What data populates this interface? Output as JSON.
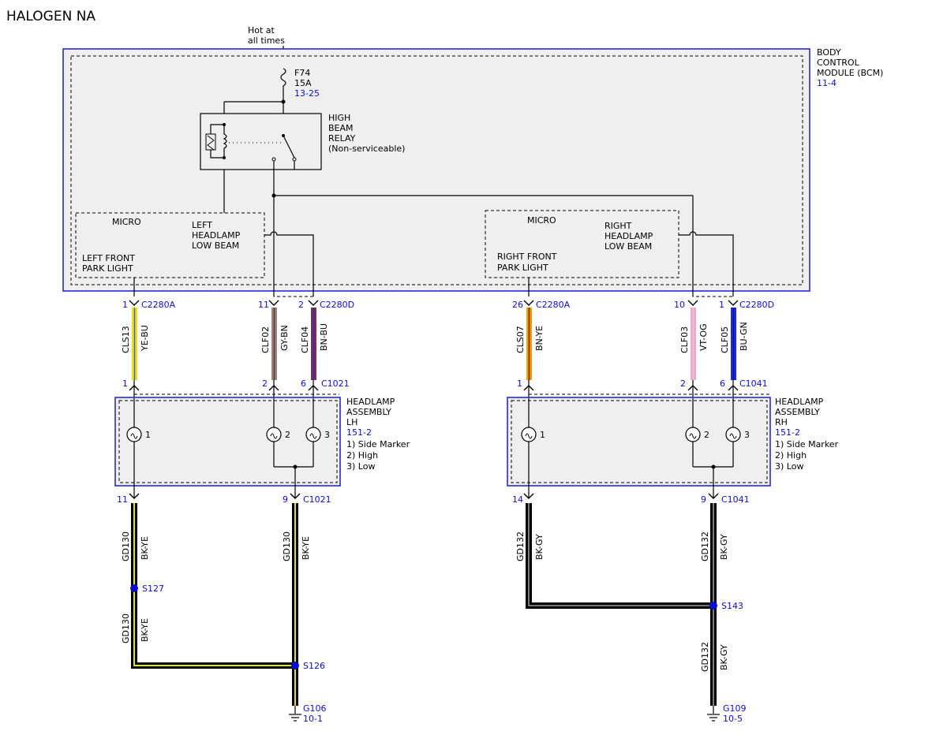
{
  "title": "HALOGEN NA",
  "power": {
    "line1": "Hot at",
    "line2": "all times"
  },
  "fuse": {
    "name": "F74",
    "rating": "15A",
    "ref": "13-25"
  },
  "bcm": {
    "line1": "BODY",
    "line2": "CONTROL",
    "line3": "MODULE (BCM)",
    "ref": "11-4"
  },
  "relay": {
    "line1": "HIGH",
    "line2": "BEAM",
    "line3": "RELAY",
    "line4": "(Non-serviceable)"
  },
  "micro_left": {
    "title": "MICRO",
    "low_beam": [
      "LEFT",
      "HEADLAMP",
      "LOW BEAM"
    ],
    "park": [
      "LEFT FRONT",
      "PARK LIGHT"
    ]
  },
  "micro_right": {
    "title": "MICRO",
    "low_beam": [
      "RIGHT",
      "HEADLAMP",
      "LOW BEAM"
    ],
    "park": [
      "RIGHT FRONT",
      "PARK LIGHT"
    ]
  },
  "wires": [
    {
      "circuit": "CLS13",
      "color_code": "YE-BU",
      "top_pin": "1",
      "top_conn": "C2280A",
      "bot_pin": "1",
      "bot_conn": ""
    },
    {
      "circuit": "CLF02",
      "color_code": "GY-BN",
      "top_pin": "11",
      "top_conn": "",
      "bot_pin": "2",
      "bot_conn": ""
    },
    {
      "circuit": "CLF04",
      "color_code": "BN-BU",
      "top_pin": "2",
      "top_conn": "C2280D",
      "bot_pin": "6",
      "bot_conn": "C1021"
    },
    {
      "circuit": "CLS07",
      "color_code": "BN-YE",
      "top_pin": "26",
      "top_conn": "C2280A",
      "bot_pin": "1",
      "bot_conn": ""
    },
    {
      "circuit": "CLF03",
      "color_code": "VT-OG",
      "top_pin": "10",
      "top_conn": "",
      "bot_pin": "2",
      "bot_conn": ""
    },
    {
      "circuit": "CLF05",
      "color_code": "BU-GN",
      "top_pin": "1",
      "top_conn": "C2280D",
      "bot_pin": "6",
      "bot_conn": "C1041"
    }
  ],
  "headlamp_lh": {
    "title": [
      "HEADLAMP",
      "ASSEMBLY",
      "LH"
    ],
    "ref": "151-2",
    "items": [
      "1) Side Marker",
      "2) High",
      "3) Low"
    ],
    "bulbs": [
      "1",
      "2",
      "3"
    ]
  },
  "headlamp_rh": {
    "title": [
      "HEADLAMP",
      "ASSEMBLY",
      "RH"
    ],
    "ref": "151-2",
    "items": [
      "1) Side Marker",
      "2) High",
      "3) Low"
    ],
    "bulbs": [
      "1",
      "2",
      "3"
    ]
  },
  "ground_lh": {
    "pin_a": "11",
    "pin_b": "9",
    "conn": "C1021",
    "circuit": "GD130",
    "color_code": "BK-YE",
    "splice_1": "S127",
    "splice_2": "S126",
    "ground": "G106",
    "ground_ref": "10-1"
  },
  "ground_rh": {
    "pin_a": "14",
    "pin_b": "9",
    "conn": "C1041",
    "circuit": "GD132",
    "color_code": "BK-GY",
    "splice": "S143",
    "ground": "G109",
    "ground_ref": "10-5"
  },
  "colors": {
    "accent_blue": "#0b0bd8",
    "panel_fill": "#efefef",
    "wire_ye_bu": [
      "#e6e600",
      "#1a1aff"
    ],
    "wire_gy_bn": [
      "#8a8a8a",
      "#8b4a1a"
    ],
    "wire_bn_bu": [
      "#8b4a1a",
      "#2b2bd0"
    ],
    "wire_bn_ye": [
      "#8b4a1a",
      "#e6c800"
    ],
    "wire_vt_og": [
      "#f4a6c8",
      "#ff8c2e"
    ],
    "wire_bu_gn": [
      "#1a2bd0",
      "#0a8a0a"
    ],
    "wire_bk_ye": [
      "#000000",
      "#e6e600"
    ],
    "wire_bk_gy": [
      "#000000",
      "#9a9a9a"
    ]
  }
}
